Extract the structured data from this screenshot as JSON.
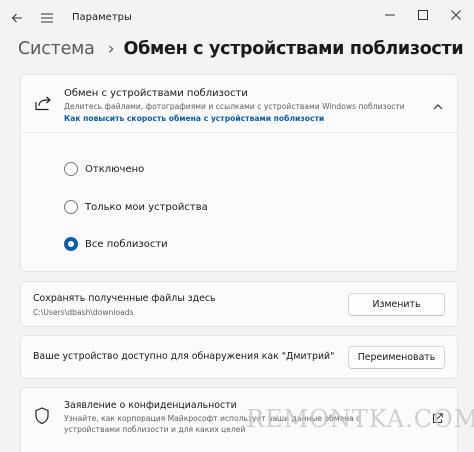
{
  "window": {
    "app_title": "Параметры",
    "controls": [
      "minimize-icon",
      "maximize-icon",
      "close-icon"
    ]
  },
  "breadcrumb": {
    "root": "Система",
    "separator": "›",
    "current": "Обмен с устройствами поблизости"
  },
  "nearby_sharing": {
    "icon": "share-icon",
    "title": "Обмен с устройствами поблизости",
    "description": "Делитесь файлами, фотографиями и ссылками с устройствами Windows поблизости",
    "link": "Как повысить скорость обмена с устройствами поблизости",
    "expanded": true,
    "options": [
      {
        "label": "Отключено",
        "selected": false
      },
      {
        "label": "Только мои устройства",
        "selected": false
      },
      {
        "label": "Все поблизости",
        "selected": true
      }
    ]
  },
  "save_location": {
    "title": "Сохранять полученные файлы здесь",
    "path": "C:\\Users\\dbash\\downloads",
    "button": "Изменить"
  },
  "discoverable": {
    "title": "Ваше устройство доступно для обнаружения как \"Дмитрий\"",
    "button": "Переименовать"
  },
  "privacy": {
    "icon": "shield-icon",
    "title": "Заявление о конфиденциальности",
    "description_line1": "Узнайте, как корпорация Майкрософт использует ваши данные обмена с",
    "description_line2": "устройствами поблизости и для каких целей"
  },
  "watermark": "REMONTKA.COM",
  "colors": {
    "accent": "#0b5fa8",
    "background": "#f3f3f3",
    "card": "#fbfbfb"
  }
}
